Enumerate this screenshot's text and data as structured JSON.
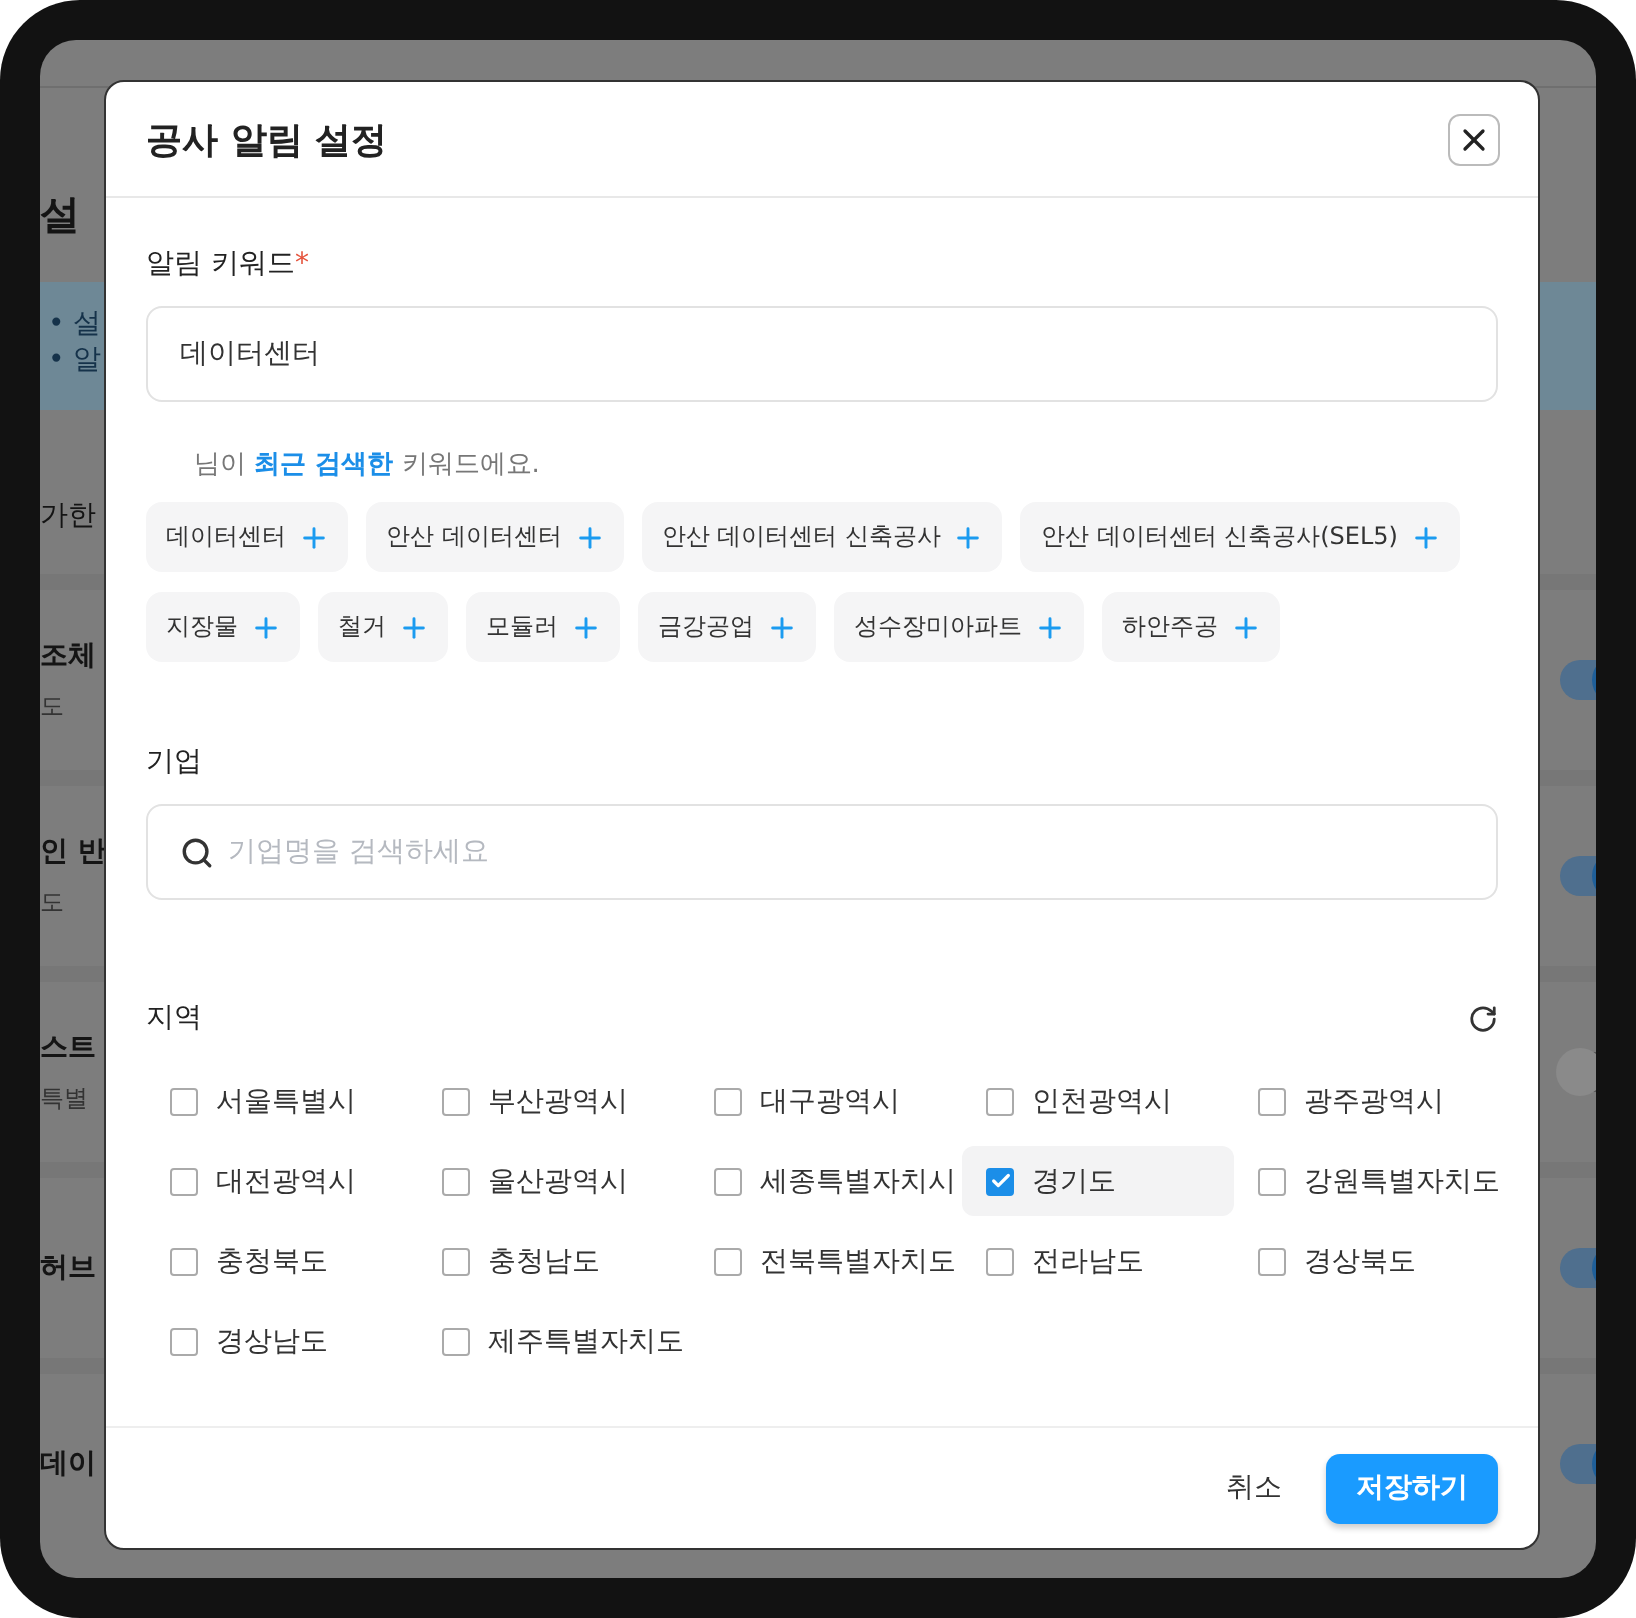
{
  "background": {
    "heading": "설",
    "notes": [
      {
        "bullet": "•",
        "text": "설"
      },
      {
        "bullet": "•",
        "text": "알"
      }
    ],
    "section": "가한",
    "rows": [
      {
        "title": "조체",
        "subtitle": "도",
        "on": true
      },
      {
        "title": "인 반",
        "subtitle": "도",
        "on": true
      },
      {
        "title": "스트",
        "subtitle": "특별",
        "on": false
      },
      {
        "title": "허브",
        "on": true
      },
      {
        "title": "데이",
        "on": true
      }
    ]
  },
  "dialog": {
    "title": "공사 알림 설정",
    "keyword": {
      "label": "알림 키워드",
      "required_mark": "*",
      "value": "데이터센터"
    },
    "recent_hint": "님이 **최근 검색한** 키워드에요.",
    "recent_keywords": [
      "데이터센터",
      "안산 데이터센터",
      "안산 데이터센터 신축공사",
      "안산 데이터센터 신축공사(SEL5)",
      "지장물",
      "철거",
      "모듈러",
      "금강공업",
      "성수장미아파트",
      "하안주공"
    ],
    "company": {
      "label": "기업",
      "placeholder": "기업명을 검색하세요"
    },
    "region": {
      "label": "지역",
      "options": [
        {
          "label": "서울특별시",
          "checked": false
        },
        {
          "label": "부산광역시",
          "checked": false
        },
        {
          "label": "대구광역시",
          "checked": false
        },
        {
          "label": "인천광역시",
          "checked": false
        },
        {
          "label": "광주광역시",
          "checked": false
        },
        {
          "label": "대전광역시",
          "checked": false
        },
        {
          "label": "울산광역시",
          "checked": false
        },
        {
          "label": "세종특별자치시",
          "checked": false
        },
        {
          "label": "경기도",
          "checked": true
        },
        {
          "label": "강원특별자치도",
          "checked": false
        },
        {
          "label": "충청북도",
          "checked": false
        },
        {
          "label": "충청남도",
          "checked": false
        },
        {
          "label": "전북특별자치도",
          "checked": false
        },
        {
          "label": "전라남도",
          "checked": false
        },
        {
          "label": "경상북도",
          "checked": false
        },
        {
          "label": "경상남도",
          "checked": false
        },
        {
          "label": "제주특별자치도",
          "checked": false
        }
      ]
    },
    "buttons": {
      "cancel": "취소",
      "save": "저장하기"
    }
  }
}
